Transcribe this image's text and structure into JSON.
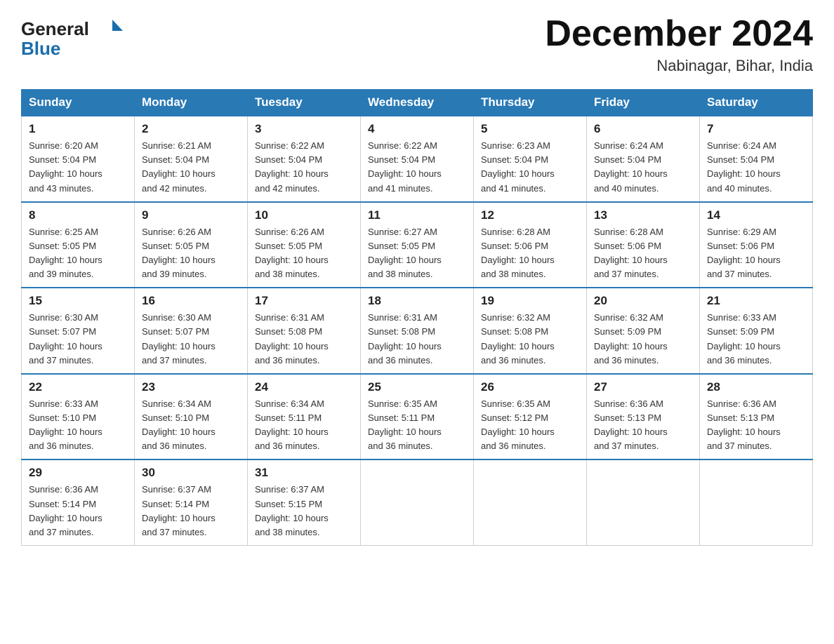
{
  "header": {
    "logo_general": "General",
    "logo_blue": "Blue",
    "month_title": "December 2024",
    "location": "Nabinagar, Bihar, India"
  },
  "days_of_week": [
    "Sunday",
    "Monday",
    "Tuesday",
    "Wednesday",
    "Thursday",
    "Friday",
    "Saturday"
  ],
  "weeks": [
    [
      {
        "day": "1",
        "sunrise": "6:20 AM",
        "sunset": "5:04 PM",
        "daylight": "10 hours and 43 minutes."
      },
      {
        "day": "2",
        "sunrise": "6:21 AM",
        "sunset": "5:04 PM",
        "daylight": "10 hours and 42 minutes."
      },
      {
        "day": "3",
        "sunrise": "6:22 AM",
        "sunset": "5:04 PM",
        "daylight": "10 hours and 42 minutes."
      },
      {
        "day": "4",
        "sunrise": "6:22 AM",
        "sunset": "5:04 PM",
        "daylight": "10 hours and 41 minutes."
      },
      {
        "day": "5",
        "sunrise": "6:23 AM",
        "sunset": "5:04 PM",
        "daylight": "10 hours and 41 minutes."
      },
      {
        "day": "6",
        "sunrise": "6:24 AM",
        "sunset": "5:04 PM",
        "daylight": "10 hours and 40 minutes."
      },
      {
        "day": "7",
        "sunrise": "6:24 AM",
        "sunset": "5:04 PM",
        "daylight": "10 hours and 40 minutes."
      }
    ],
    [
      {
        "day": "8",
        "sunrise": "6:25 AM",
        "sunset": "5:05 PM",
        "daylight": "10 hours and 39 minutes."
      },
      {
        "day": "9",
        "sunrise": "6:26 AM",
        "sunset": "5:05 PM",
        "daylight": "10 hours and 39 minutes."
      },
      {
        "day": "10",
        "sunrise": "6:26 AM",
        "sunset": "5:05 PM",
        "daylight": "10 hours and 38 minutes."
      },
      {
        "day": "11",
        "sunrise": "6:27 AM",
        "sunset": "5:05 PM",
        "daylight": "10 hours and 38 minutes."
      },
      {
        "day": "12",
        "sunrise": "6:28 AM",
        "sunset": "5:06 PM",
        "daylight": "10 hours and 38 minutes."
      },
      {
        "day": "13",
        "sunrise": "6:28 AM",
        "sunset": "5:06 PM",
        "daylight": "10 hours and 37 minutes."
      },
      {
        "day": "14",
        "sunrise": "6:29 AM",
        "sunset": "5:06 PM",
        "daylight": "10 hours and 37 minutes."
      }
    ],
    [
      {
        "day": "15",
        "sunrise": "6:30 AM",
        "sunset": "5:07 PM",
        "daylight": "10 hours and 37 minutes."
      },
      {
        "day": "16",
        "sunrise": "6:30 AM",
        "sunset": "5:07 PM",
        "daylight": "10 hours and 37 minutes."
      },
      {
        "day": "17",
        "sunrise": "6:31 AM",
        "sunset": "5:08 PM",
        "daylight": "10 hours and 36 minutes."
      },
      {
        "day": "18",
        "sunrise": "6:31 AM",
        "sunset": "5:08 PM",
        "daylight": "10 hours and 36 minutes."
      },
      {
        "day": "19",
        "sunrise": "6:32 AM",
        "sunset": "5:08 PM",
        "daylight": "10 hours and 36 minutes."
      },
      {
        "day": "20",
        "sunrise": "6:32 AM",
        "sunset": "5:09 PM",
        "daylight": "10 hours and 36 minutes."
      },
      {
        "day": "21",
        "sunrise": "6:33 AM",
        "sunset": "5:09 PM",
        "daylight": "10 hours and 36 minutes."
      }
    ],
    [
      {
        "day": "22",
        "sunrise": "6:33 AM",
        "sunset": "5:10 PM",
        "daylight": "10 hours and 36 minutes."
      },
      {
        "day": "23",
        "sunrise": "6:34 AM",
        "sunset": "5:10 PM",
        "daylight": "10 hours and 36 minutes."
      },
      {
        "day": "24",
        "sunrise": "6:34 AM",
        "sunset": "5:11 PM",
        "daylight": "10 hours and 36 minutes."
      },
      {
        "day": "25",
        "sunrise": "6:35 AM",
        "sunset": "5:11 PM",
        "daylight": "10 hours and 36 minutes."
      },
      {
        "day": "26",
        "sunrise": "6:35 AM",
        "sunset": "5:12 PM",
        "daylight": "10 hours and 36 minutes."
      },
      {
        "day": "27",
        "sunrise": "6:36 AM",
        "sunset": "5:13 PM",
        "daylight": "10 hours and 37 minutes."
      },
      {
        "day": "28",
        "sunrise": "6:36 AM",
        "sunset": "5:13 PM",
        "daylight": "10 hours and 37 minutes."
      }
    ],
    [
      {
        "day": "29",
        "sunrise": "6:36 AM",
        "sunset": "5:14 PM",
        "daylight": "10 hours and 37 minutes."
      },
      {
        "day": "30",
        "sunrise": "6:37 AM",
        "sunset": "5:14 PM",
        "daylight": "10 hours and 37 minutes."
      },
      {
        "day": "31",
        "sunrise": "6:37 AM",
        "sunset": "5:15 PM",
        "daylight": "10 hours and 38 minutes."
      },
      null,
      null,
      null,
      null
    ]
  ],
  "labels": {
    "sunrise": "Sunrise:",
    "sunset": "Sunset:",
    "daylight": "Daylight:"
  }
}
